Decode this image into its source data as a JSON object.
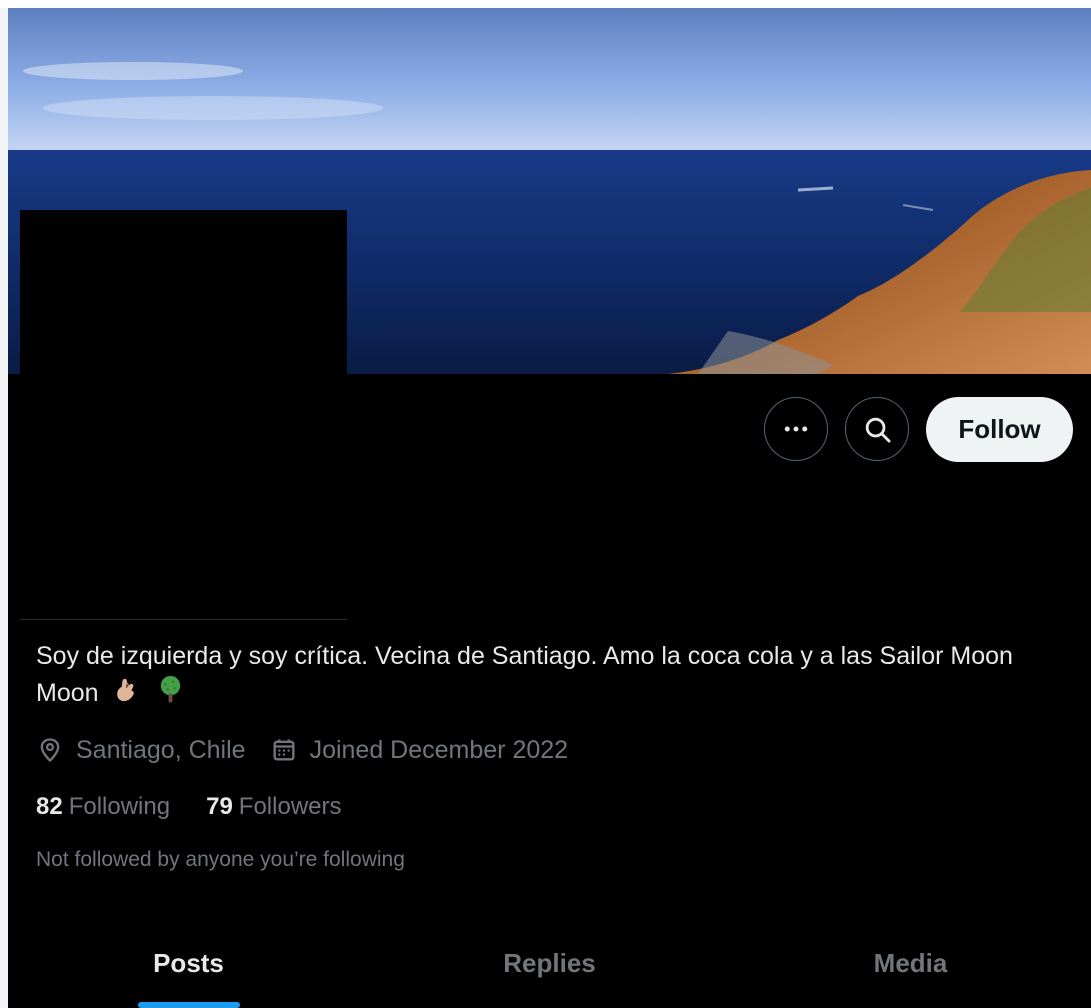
{
  "profile": {
    "bio_text": "Soy de izquierda y soy crítica. Vecina de Santiago. Amo la coca cola y a las Sailor Moon",
    "bio_emoji_1": "crossed-fingers-emoji",
    "bio_emoji_2": "tree-emoji",
    "location": "Santiago, Chile",
    "joined": "Joined December 2022",
    "following_count": "82",
    "following_label": "Following",
    "followers_count": "79",
    "followers_label": "Followers",
    "followed_notice": "Not followed by anyone you’re following"
  },
  "actions": {
    "more_icon": "more-horizontal-icon",
    "search_icon": "search-icon",
    "follow_label": "Follow"
  },
  "tabs": [
    {
      "label": "Posts",
      "active": true
    },
    {
      "label": "Replies",
      "active": false
    },
    {
      "label": "Media",
      "active": false
    }
  ],
  "colors": {
    "background": "#000000",
    "primary_text": "#e7e9ea",
    "secondary_text": "#71767b",
    "follow_button_bg": "#eff3f4",
    "active_tab_indicator": "#1d9bf0"
  }
}
